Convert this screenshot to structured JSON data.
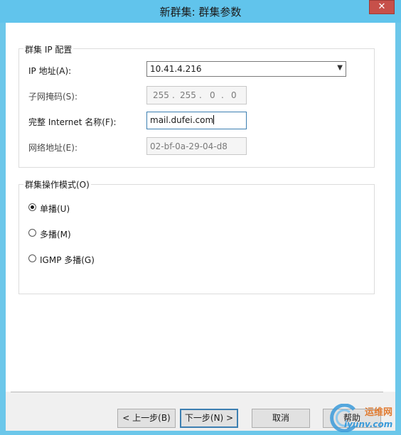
{
  "window": {
    "title": "新群集: 群集参数",
    "close_glyph": "✕"
  },
  "cluster_ip": {
    "group_label": "群集 IP 配置",
    "ip_label": "IP 地址(A):",
    "ip_value": "10.41.4.216",
    "subnet_label": "子网掩码(S):",
    "subnet_octets": [
      "255",
      "255",
      "0",
      "0"
    ],
    "fqdn_label": "完整 Internet 名称(F):",
    "fqdn_value": "mail.dufei.com",
    "mac_label": "网络地址(E):",
    "mac_value": "02-bf-0a-29-04-d8"
  },
  "mode": {
    "group_label": "群集操作模式(O)",
    "options": [
      {
        "label": "单播(U)",
        "checked": true
      },
      {
        "label": "多播(M)",
        "checked": false
      },
      {
        "label": "IGMP 多播(G)",
        "checked": false
      }
    ]
  },
  "buttons": {
    "back": "< 上一步(B)",
    "next": "下一步(N) >",
    "cancel": "取消",
    "help": "帮助"
  },
  "watermark": {
    "line1": "运维网",
    "line2": "iyunv.com"
  },
  "colors": {
    "titlebar": "#61c4ec",
    "close": "#c7504a",
    "accent": "#3c7fb1"
  }
}
